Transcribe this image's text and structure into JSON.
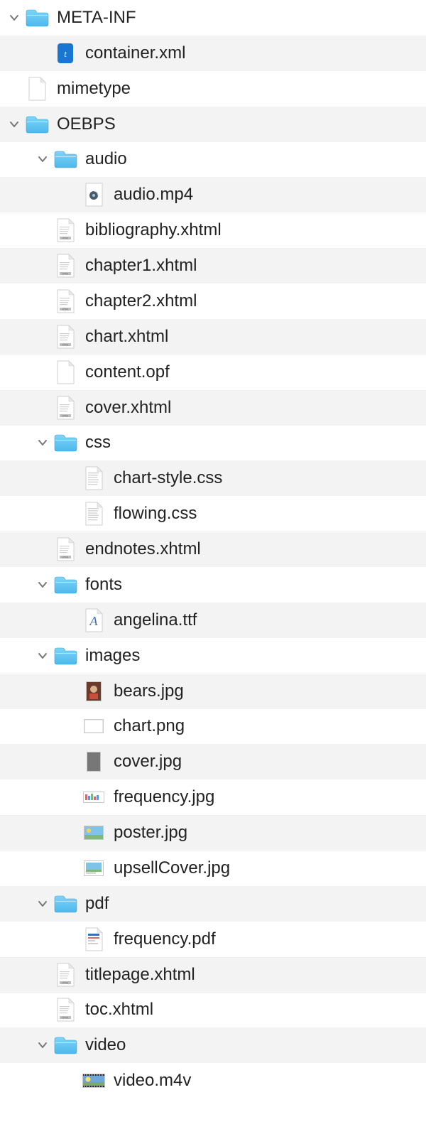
{
  "rows": [
    {
      "depth": 0,
      "arrow": true,
      "icon": "folder",
      "label": "META-INF"
    },
    {
      "depth": 1,
      "arrow": false,
      "icon": "xml",
      "label": "container.xml"
    },
    {
      "depth": 0,
      "arrow": false,
      "icon": "blank",
      "label": "mimetype"
    },
    {
      "depth": 0,
      "arrow": true,
      "icon": "folder",
      "label": "OEBPS"
    },
    {
      "depth": 1,
      "arrow": true,
      "icon": "folder",
      "label": "audio"
    },
    {
      "depth": 2,
      "arrow": false,
      "icon": "media",
      "label": "audio.mp4"
    },
    {
      "depth": 1,
      "arrow": false,
      "icon": "html",
      "label": "bibliography.xhtml"
    },
    {
      "depth": 1,
      "arrow": false,
      "icon": "html",
      "label": "chapter1.xhtml"
    },
    {
      "depth": 1,
      "arrow": false,
      "icon": "html",
      "label": "chapter2.xhtml"
    },
    {
      "depth": 1,
      "arrow": false,
      "icon": "html",
      "label": "chart.xhtml"
    },
    {
      "depth": 1,
      "arrow": false,
      "icon": "blank",
      "label": "content.opf"
    },
    {
      "depth": 1,
      "arrow": false,
      "icon": "html",
      "label": "cover.xhtml"
    },
    {
      "depth": 1,
      "arrow": true,
      "icon": "folder",
      "label": "css"
    },
    {
      "depth": 2,
      "arrow": false,
      "icon": "text",
      "label": "chart-style.css"
    },
    {
      "depth": 2,
      "arrow": false,
      "icon": "text",
      "label": "flowing.css"
    },
    {
      "depth": 1,
      "arrow": false,
      "icon": "html",
      "label": "endnotes.xhtml"
    },
    {
      "depth": 1,
      "arrow": true,
      "icon": "folder",
      "label": "fonts"
    },
    {
      "depth": 2,
      "arrow": false,
      "icon": "font",
      "label": "angelina.ttf"
    },
    {
      "depth": 1,
      "arrow": true,
      "icon": "folder",
      "label": "images"
    },
    {
      "depth": 2,
      "arrow": false,
      "icon": "img-photo",
      "label": "bears.jpg"
    },
    {
      "depth": 2,
      "arrow": false,
      "icon": "img-blank",
      "label": "chart.png"
    },
    {
      "depth": 2,
      "arrow": false,
      "icon": "img-gray",
      "label": "cover.jpg"
    },
    {
      "depth": 2,
      "arrow": false,
      "icon": "img-wide",
      "label": "frequency.jpg"
    },
    {
      "depth": 2,
      "arrow": false,
      "icon": "img-sky",
      "label": "poster.jpg"
    },
    {
      "depth": 2,
      "arrow": false,
      "icon": "img-up",
      "label": "upsellCover.jpg"
    },
    {
      "depth": 1,
      "arrow": true,
      "icon": "folder",
      "label": "pdf"
    },
    {
      "depth": 2,
      "arrow": false,
      "icon": "pdf",
      "label": "frequency.pdf"
    },
    {
      "depth": 1,
      "arrow": false,
      "icon": "html",
      "label": "titlepage.xhtml"
    },
    {
      "depth": 1,
      "arrow": false,
      "icon": "html",
      "label": "toc.xhtml"
    },
    {
      "depth": 1,
      "arrow": true,
      "icon": "folder",
      "label": "video"
    },
    {
      "depth": 2,
      "arrow": false,
      "icon": "video",
      "label": "video.m4v"
    }
  ]
}
